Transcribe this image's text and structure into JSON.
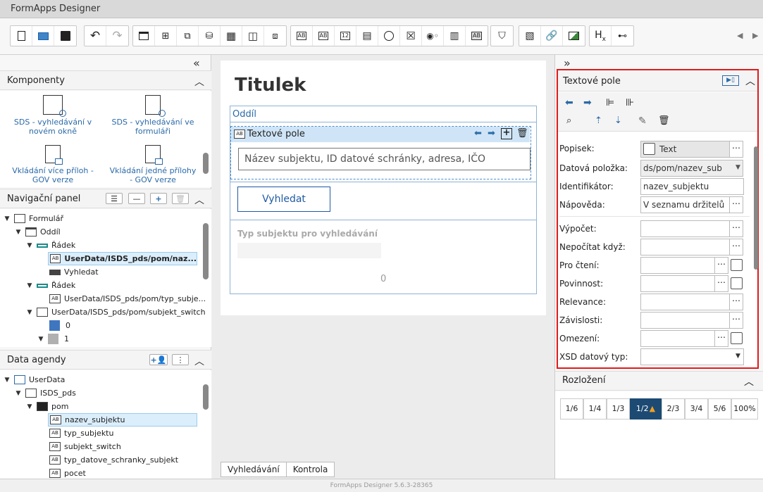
{
  "app": {
    "title": "FormApps Designer",
    "version": "FormApps Designer 5.6.3-28365"
  },
  "toolbar": {
    "buttons": [
      {
        "name": "new-file-icon",
        "glyph": "🗋"
      },
      {
        "name": "open-folder-icon",
        "glyph": "📂"
      },
      {
        "name": "save-icon",
        "glyph": "💾"
      },
      {
        "name": "undo-icon",
        "glyph": "↶"
      },
      {
        "name": "redo-icon",
        "glyph": "↷"
      }
    ],
    "text_labels": {
      "ab": "AB",
      "num": "12",
      "hx": "H",
      "hx_sub": "x"
    }
  },
  "left": {
    "collapse_glyph": "«",
    "components": {
      "title": "Komponenty",
      "items": [
        {
          "label": "SDS - vyhledávání v novém okně"
        },
        {
          "label": "SDS - vyhledávání ve formuláři"
        },
        {
          "label": "Vkládání více příloh - GOV verze"
        },
        {
          "label": "Vkládání jedné přílohy - GOV verze"
        }
      ]
    },
    "navigation": {
      "title": "Navigační panel",
      "rows": [
        {
          "label": "Formulář"
        },
        {
          "label": "Oddíl"
        },
        {
          "label": "Řádek"
        },
        {
          "label": "UserData/ISDS_pds/pom/naz..."
        },
        {
          "label": "Vyhledat"
        },
        {
          "label": "Řádek"
        },
        {
          "label": "UserData/ISDS_pds/pom/typ_subje..."
        },
        {
          "label": "UserData/ISDS_pds/pom/subjekt_switch"
        },
        {
          "label": "0"
        },
        {
          "label": "1"
        }
      ]
    },
    "data": {
      "title": "Data agendy",
      "rows": [
        {
          "label": "UserData"
        },
        {
          "label": "ISDS_pds"
        },
        {
          "label": "pom"
        },
        {
          "label": "nazev_subjektu"
        },
        {
          "label": "typ_subjektu"
        },
        {
          "label": "subjekt_switch"
        },
        {
          "label": "typ_datove_schranky_subjekt"
        },
        {
          "label": "pocet"
        }
      ]
    }
  },
  "canvas": {
    "title": "Titulek",
    "section": "Oddíl",
    "field_label": "Textové pole",
    "field_placeholder": "Název subjektu, ID datové schránky, adresa, IČO",
    "search_button": "Vyhledat",
    "type_label": "Typ subjektu pro vyhledávání",
    "count_value": "0",
    "tabs": [
      {
        "label": "Vyhledávání"
      },
      {
        "label": "Kontrola"
      }
    ]
  },
  "right": {
    "expand_glyph": "»",
    "props_title": "Textové pole",
    "fields": {
      "popisek": {
        "label": "Popisek:",
        "value": "Text"
      },
      "datova": {
        "label": "Datová položka:",
        "value": "ds/pom/nazev_sub"
      },
      "ident": {
        "label": "Identifikátor:",
        "value": "nazev_subjektu"
      },
      "napoveda": {
        "label": "Nápověda:",
        "value": "V seznamu držitelů"
      },
      "vypocet": {
        "label": "Výpočet:",
        "value": ""
      },
      "nepocitat": {
        "label": "Nepočítat když:",
        "value": ""
      },
      "procteni": {
        "label": "Pro čtení:",
        "value": ""
      },
      "povinnost": {
        "label": "Povinnost:",
        "value": ""
      },
      "relevance": {
        "label": "Relevance:",
        "value": ""
      },
      "zavislosti": {
        "label": "Závislosti:",
        "value": ""
      },
      "omezeni": {
        "label": "Omezení:",
        "value": ""
      },
      "xsd": {
        "label": "XSD datový typ:",
        "value": ""
      }
    },
    "layout_title": "Rozložení",
    "layout_options": [
      "1/6",
      "1/4",
      "1/3",
      "1/2",
      "2/3",
      "3/4",
      "5/6",
      "100%"
    ],
    "layout_selected": "1/2"
  },
  "colors": {
    "accent": "#2b6aa8",
    "highlight": "#e01b1b",
    "selected": "#1c4a73"
  }
}
